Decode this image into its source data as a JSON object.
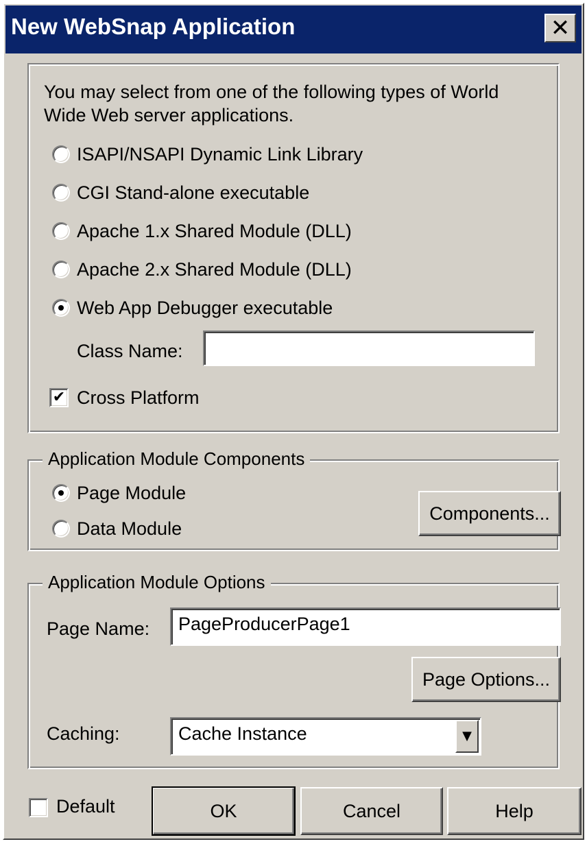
{
  "window": {
    "title": "New WebSnap Application",
    "close_glyph": "✕"
  },
  "server_types": {
    "intro_line1": "You may select from one of the following types of World",
    "intro_line2": "Wide Web server applications.",
    "options": [
      {
        "label": "ISAPI/NSAPI Dynamic Link Library",
        "selected": false
      },
      {
        "label": "CGI Stand-alone executable",
        "selected": false
      },
      {
        "label": "Apache 1.x Shared Module (DLL)",
        "selected": false
      },
      {
        "label": "Apache 2.x Shared Module (DLL)",
        "selected": false
      },
      {
        "label": "Web App Debugger executable",
        "selected": true
      }
    ],
    "class_name_label": "Class Name:",
    "class_name_value": "",
    "cross_platform_label": "Cross Platform",
    "cross_platform_checked": true
  },
  "module_components": {
    "legend": "Application Module Components",
    "page_module_label": "Page Module",
    "data_module_label": "Data Module",
    "selected": "Page Module",
    "components_button": "Components..."
  },
  "module_options": {
    "legend": "Application Module Options",
    "page_name_label": "Page Name:",
    "page_name_value": "PageProducerPage1",
    "page_options_button": "Page Options...",
    "caching_label": "Caching:",
    "caching_value": "Cache Instance"
  },
  "footer": {
    "default_label": "Default",
    "default_checked": false,
    "ok_button": "OK",
    "cancel_button": "Cancel",
    "help_button": "Help"
  },
  "icons": {
    "check_glyph": "✔",
    "dropdown_glyph": "▼"
  }
}
